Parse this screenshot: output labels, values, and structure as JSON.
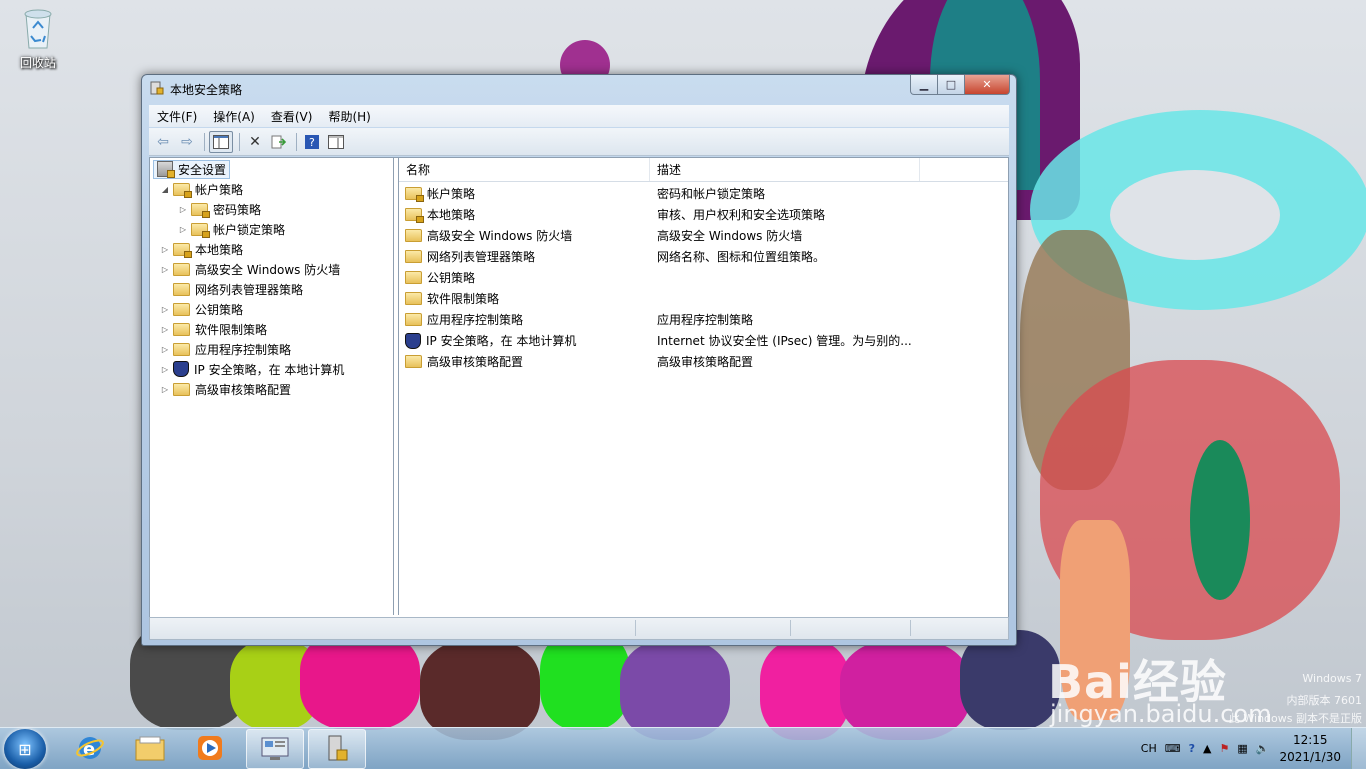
{
  "desktop": {
    "recycle_bin_label": "回收站"
  },
  "window": {
    "title": "本地安全策略",
    "menu": [
      "文件(F)",
      "操作(A)",
      "查看(V)",
      "帮助(H)"
    ]
  },
  "tree": {
    "root": "安全设置",
    "items": [
      {
        "label": "帐户策略",
        "expanded": true,
        "lock": true
      },
      {
        "label": "密码策略",
        "lock": true
      },
      {
        "label": "帐户锁定策略",
        "lock": true
      },
      {
        "label": "本地策略",
        "lock": true
      },
      {
        "label": "高级安全 Windows 防火墙"
      },
      {
        "label": "网络列表管理器策略"
      },
      {
        "label": "公钥策略"
      },
      {
        "label": "软件限制策略"
      },
      {
        "label": "应用程序控制策略"
      },
      {
        "label": "IP 安全策略，在 本地计算机",
        "icon": "shield-icon"
      },
      {
        "label": "高级审核策略配置"
      }
    ]
  },
  "list": {
    "columns": [
      "名称",
      "描述"
    ],
    "rows": [
      {
        "name": "帐户策略",
        "desc": "密码和帐户锁定策略",
        "lock": true
      },
      {
        "name": "本地策略",
        "desc": "审核、用户权利和安全选项策略",
        "lock": true
      },
      {
        "name": "高级安全 Windows 防火墙",
        "desc": "高级安全 Windows 防火墙"
      },
      {
        "name": "网络列表管理器策略",
        "desc": "网络名称、图标和位置组策略。"
      },
      {
        "name": "公钥策略",
        "desc": ""
      },
      {
        "name": "软件限制策略",
        "desc": ""
      },
      {
        "name": "应用程序控制策略",
        "desc": "应用程序控制策略"
      },
      {
        "name": "IP 安全策略，在 本地计算机",
        "desc": "Internet 协议安全性 (IPsec) 管理。为与别的...",
        "icon": "shield-icon"
      },
      {
        "name": "高级审核策略配置",
        "desc": "高级审核策略配置"
      }
    ]
  },
  "taskbar": {
    "lang": "CH",
    "time": "12:15",
    "date": "2021/1/30"
  },
  "watermark": {
    "line1": "Windows 7",
    "line2": "内部版本 7601",
    "line3": "此 Windows 副本不是正版",
    "brand": "Bai经验",
    "site": "jingyan.baidu.com"
  }
}
